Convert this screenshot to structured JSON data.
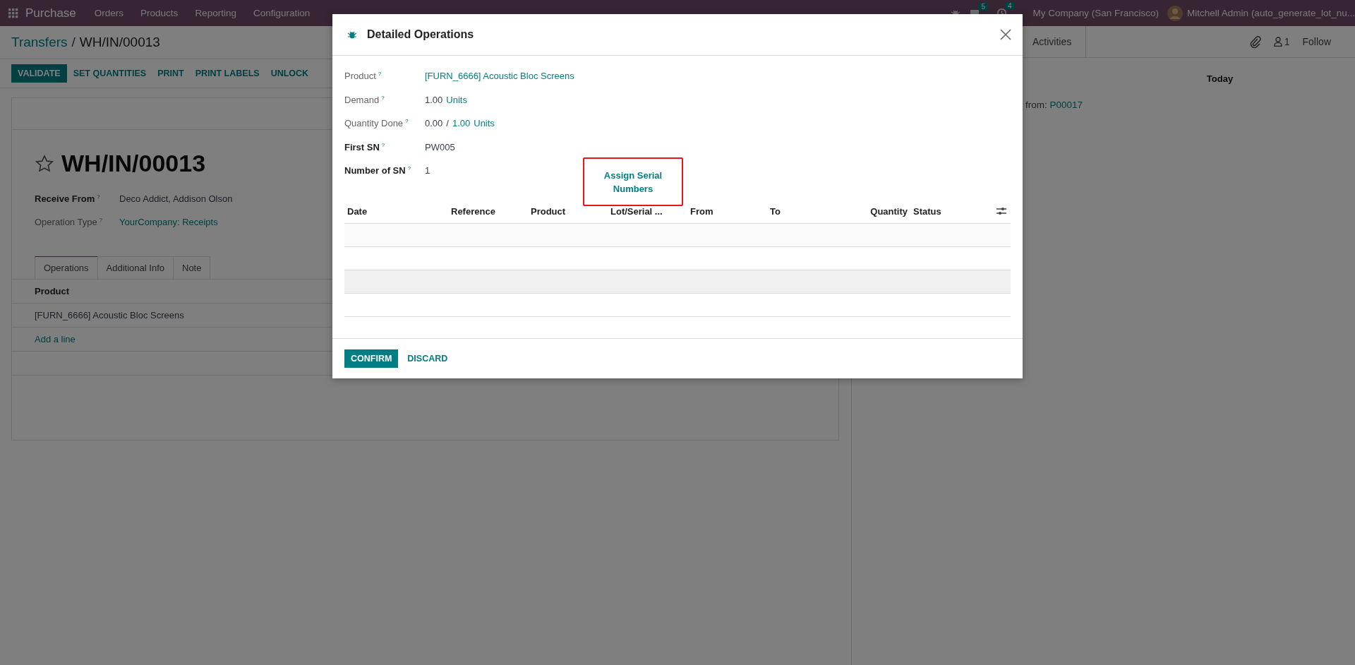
{
  "navbar": {
    "app": "Purchase",
    "menu": [
      "Orders",
      "Products",
      "Reporting",
      "Configuration"
    ],
    "chat_count": "5",
    "activity_count": "4",
    "company": "My Company (San Francisco)",
    "user": "Mitchell Admin (auto_generate_lot_nu..."
  },
  "breadcrumb": {
    "parent": "Transfers",
    "separator": "/",
    "current": "WH/IN/00013"
  },
  "action_buttons": [
    {
      "label": "VALIDATE",
      "kind": "primary"
    },
    {
      "label": "SET QUANTITIES",
      "kind": "secondary"
    },
    {
      "label": "PRINT",
      "kind": "secondary"
    },
    {
      "label": "PRINT LABELS",
      "kind": "secondary"
    },
    {
      "label": "UNLOCK",
      "kind": "secondary"
    }
  ],
  "record": {
    "favorite": false,
    "name": "WH/IN/00013",
    "fields": [
      {
        "label": "Receive From",
        "help": "?",
        "required": true,
        "value": "Deco Addict, Addison Olson",
        "kind": "text"
      },
      {
        "label": "Operation Type",
        "help": "?",
        "required": false,
        "value": "YourCompany: Receipts",
        "kind": "link"
      }
    ],
    "tabs": [
      {
        "label": "Operations",
        "selected": true
      },
      {
        "label": "Additional Info",
        "selected": false
      },
      {
        "label": "Note",
        "selected": false
      }
    ],
    "lines": {
      "column": "Product",
      "rows": [
        "[FURN_6666] Acoustic Bloc Screens"
      ],
      "add_line": "Add a line"
    }
  },
  "chatter": {
    "activities": "Activities",
    "followers": "1",
    "follow": "Follow",
    "date_separator": "Today",
    "message": {
      "text": "from:",
      "link": "P00017"
    }
  },
  "dialog": {
    "title": "Detailed Operations",
    "fields": [
      {
        "label": "Product",
        "help": "?",
        "required": false,
        "parts": [
          {
            "text": "[FURN_6666] Acoustic Bloc Screens",
            "kind": "link"
          }
        ]
      },
      {
        "label": "Demand",
        "help": "?",
        "required": false,
        "parts": [
          {
            "text": "1.00",
            "kind": "plain"
          },
          {
            "text": "Units",
            "kind": "link"
          }
        ]
      },
      {
        "label": "Quantity Done",
        "help": "?",
        "required": false,
        "parts": [
          {
            "text": "0.00",
            "kind": "plain"
          },
          {
            "text": "/",
            "kind": "plain"
          },
          {
            "text": "1.00",
            "kind": "link"
          },
          {
            "text": "Units",
            "kind": "link"
          }
        ]
      },
      {
        "label": "First SN",
        "help": "?",
        "required": true,
        "parts": [
          {
            "text": "PW005",
            "kind": "plain"
          }
        ]
      },
      {
        "label": "Number of SN",
        "help": "?",
        "required": true,
        "parts": [
          {
            "text": "1",
            "kind": "plain"
          }
        ]
      }
    ],
    "assign_button": "Assign Serial Numbers",
    "columns": [
      "Date",
      "Reference",
      "Product",
      "Lot/Serial ...",
      "From",
      "To",
      "Quantity",
      "Status"
    ],
    "rows": [
      {
        "kind": "striped"
      },
      {
        "kind": "plain"
      },
      {
        "kind": "hover"
      },
      {
        "kind": "plain"
      }
    ],
    "buttons": [
      {
        "label": "CONFIRM",
        "kind": "primary"
      },
      {
        "label": "DISCARD",
        "kind": "secondary"
      }
    ]
  }
}
